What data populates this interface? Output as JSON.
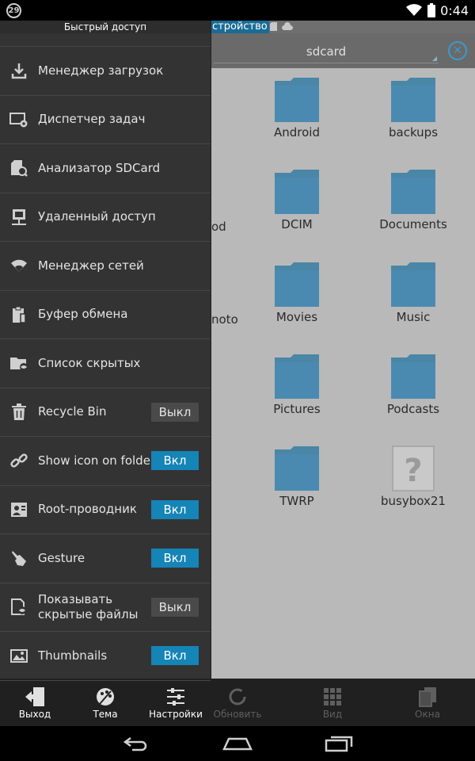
{
  "status_bar": {
    "notification_count": "29",
    "time": "0:44"
  },
  "location": {
    "path_segment": "стройство",
    "address": "sdcard"
  },
  "files": [
    {
      "name": "Android",
      "type": "folder"
    },
    {
      "name": "backups",
      "type": "folder"
    },
    {
      "name": "DCIM",
      "type": "folder"
    },
    {
      "name": "Documents",
      "type": "folder"
    },
    {
      "name": "Movies",
      "type": "folder"
    },
    {
      "name": "Music",
      "type": "folder"
    },
    {
      "name": "Pictures",
      "type": "folder"
    },
    {
      "name": "Podcasts",
      "type": "folder"
    },
    {
      "name": "TWRP",
      "type": "folder"
    },
    {
      "name": "busybox21",
      "type": "unknown"
    }
  ],
  "partial_labels": [
    "od",
    "noto"
  ],
  "toolbar": {
    "exit": "Выход",
    "theme": "Тема",
    "settings": "Настройки",
    "refresh": "Обновить",
    "view": "Вид",
    "windows": "Окна"
  },
  "drawer": {
    "title": "Быстрый доступ",
    "items": [
      {
        "label": "Менеджер загрузок",
        "icon": "download-icon"
      },
      {
        "label": "Диспетчер задач",
        "icon": "task-manager-icon"
      },
      {
        "label": "Анализатор SDCard",
        "icon": "sdcard-analyzer-icon"
      },
      {
        "label": "Удаленный доступ",
        "icon": "remote-access-icon"
      },
      {
        "label": "Менеджер сетей",
        "icon": "wifi-icon"
      },
      {
        "label": "Буфер обмена",
        "icon": "clipboard-icon"
      },
      {
        "label": "Список скрытых",
        "icon": "hidden-folder-icon"
      },
      {
        "label": "Recycle Bin",
        "icon": "trash-icon",
        "toggle": "Выкл",
        "on": false
      },
      {
        "label": "Show icon on folder",
        "icon": "link-icon",
        "toggle": "Вкл",
        "on": true
      },
      {
        "label": "Root-проводник",
        "icon": "root-explorer-icon",
        "toggle": "Вкл",
        "on": true
      },
      {
        "label": "Gesture",
        "icon": "gesture-hand-icon",
        "toggle": "Вкл",
        "on": true
      },
      {
        "label": "Показывать скрытые файлы",
        "label_line1": "Показывать",
        "label_line2": "скрытые файлы",
        "icon": "hidden-files-icon",
        "toggle": "Выкл",
        "on": false
      },
      {
        "label": "Thumbnails",
        "icon": "thumbnails-icon",
        "toggle": "Вкл",
        "on": true
      }
    ]
  },
  "colors": {
    "accent": "#1584b7",
    "folder": "#4a86a6",
    "drawer_bg": "#333333"
  }
}
